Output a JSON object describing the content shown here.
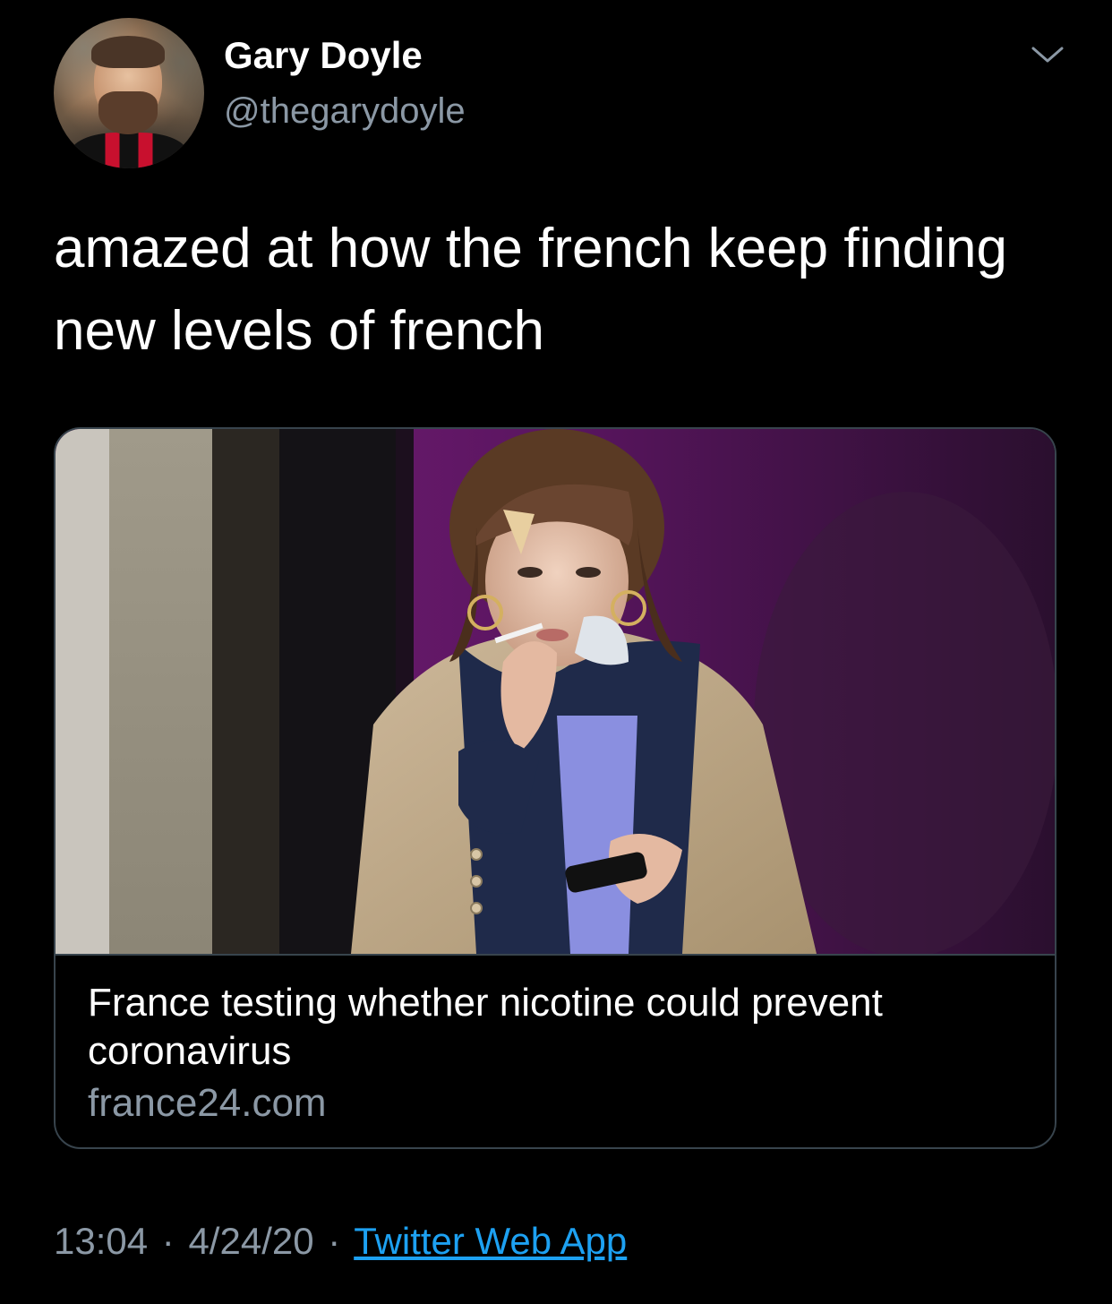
{
  "author": {
    "name": "Gary Doyle",
    "handle": "@thegarydoyle",
    "avatar_icon": "profile-avatar"
  },
  "tweet": {
    "text": "amazed at how the french keep finding new levels of french"
  },
  "link_card": {
    "title": "France testing whether nicotine could prevent coronavirus",
    "domain": "france24.com",
    "image_icon": "photo-woman-smoking-cigarette"
  },
  "meta": {
    "time": "13:04",
    "separator": "·",
    "date": "4/24/20",
    "source": "Twitter Web App"
  },
  "colors": {
    "background": "#000000",
    "primary_text": "#ffffff",
    "secondary_text": "#8b98a5",
    "link": "#1da1f2",
    "border": "#38444d"
  },
  "icons": {
    "menu": "chevron-down-icon"
  }
}
